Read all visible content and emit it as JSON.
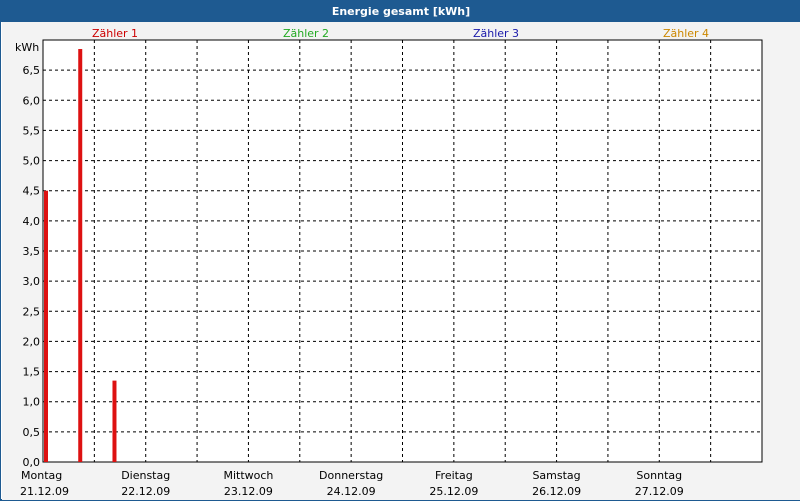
{
  "window": {
    "title": "Energie gesamt [kWh]"
  },
  "colors": {
    "titlebar": "#1e5a91",
    "meter1": "#cc0000",
    "meter2": "#22aa22",
    "meter3": "#1a1aaa",
    "meter4": "#cc8800",
    "bar": "#dd1111"
  },
  "chart_data": {
    "type": "bar",
    "title": "Energie gesamt [kWh]",
    "ylabel": "kWh",
    "ylim": [
      0,
      7
    ],
    "yticks": [
      "0,0",
      "0,5",
      "1,0",
      "1,5",
      "2,0",
      "2,5",
      "3,0",
      "3,5",
      "4,0",
      "4,5",
      "5,0",
      "5,5",
      "6,0",
      "6,5"
    ],
    "legend": [
      {
        "label": "Zähler 1",
        "color": "#cc0000"
      },
      {
        "label": "Zähler 2",
        "color": "#22aa22"
      },
      {
        "label": "Zähler 3",
        "color": "#1a1aaa"
      },
      {
        "label": "Zähler 4",
        "color": "#cc8800"
      }
    ],
    "days": [
      {
        "day": "Montag",
        "date": "21.12.09"
      },
      {
        "day": "Dienstag",
        "date": "22.12.09"
      },
      {
        "day": "Mittwoch",
        "date": "23.12.09"
      },
      {
        "day": "Donnerstag",
        "date": "24.12.09"
      },
      {
        "day": "Freitag",
        "date": "25.12.09"
      },
      {
        "day": "Samstag",
        "date": "26.12.09"
      },
      {
        "day": "Sonntag",
        "date": "27.12.09"
      }
    ],
    "series": [
      {
        "name": "Zähler 1",
        "points": [
          {
            "time": "21.12.09 00:00",
            "value": 4.5
          },
          {
            "time": "21.12.09 08:00",
            "value": 6.85
          },
          {
            "time": "21.12.09 16:00",
            "value": 1.35
          }
        ]
      }
    ],
    "grid": true
  }
}
